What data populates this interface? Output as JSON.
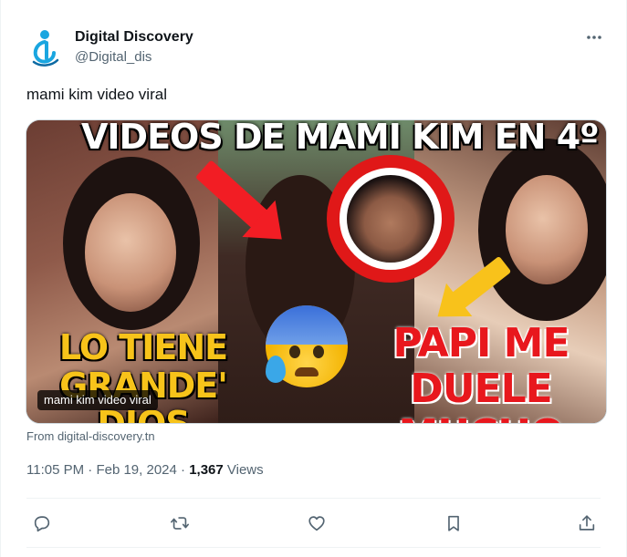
{
  "author": {
    "display_name": "Digital Discovery",
    "handle": "@Digital_dis"
  },
  "tweet": {
    "text": "mami kim video viral"
  },
  "media": {
    "headline": "VIDEOS DE MAMI KIM EN 4º",
    "caption_left": "LO TIENE GRANDE' DIOS",
    "caption_right": "PAPI ME DUELE MUCHO",
    "alt_label": "mami kim video viral"
  },
  "source": {
    "label": "From digital-discovery.tn"
  },
  "meta": {
    "time": "11:05 PM",
    "separator_1": " · ",
    "date": "Feb 19, 2024",
    "separator_2": " · ",
    "views_count": "1,367",
    "views_label": " Views"
  },
  "colors": {
    "text_primary": "#0f1419",
    "text_secondary": "#536471",
    "divider": "#eff3f4",
    "logo_blue": "#1aa6e0"
  },
  "icons": [
    "logo-icon",
    "more-icon",
    "reply-icon",
    "retweet-icon",
    "like-icon",
    "bookmark-icon",
    "share-icon"
  ]
}
